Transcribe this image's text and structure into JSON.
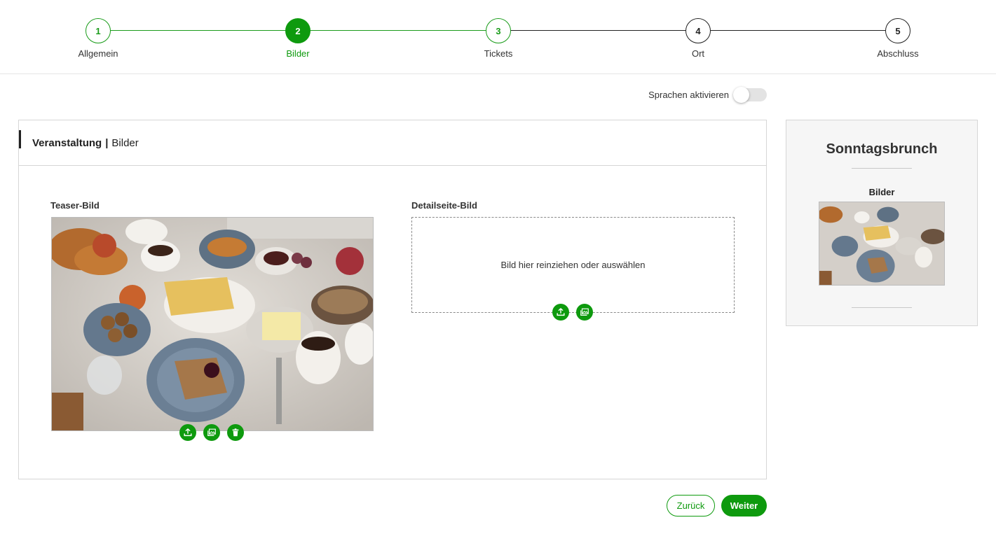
{
  "stepper": {
    "steps": [
      {
        "number": "1",
        "label": "Allgemein",
        "state": "done"
      },
      {
        "number": "2",
        "label": "Bilder",
        "state": "active"
      },
      {
        "number": "3",
        "label": "Tickets",
        "state": "done"
      },
      {
        "number": "4",
        "label": "Ort",
        "state": "pending"
      },
      {
        "number": "5",
        "label": "Abschluss",
        "state": "pending"
      }
    ],
    "colors": {
      "active": "#0e9a0e",
      "done": "#1a9c1a",
      "pending": "#222222"
    }
  },
  "language_toggle": {
    "label": "Sprachen aktivieren",
    "enabled": false
  },
  "card": {
    "title_bold": "Veranstaltung",
    "separator": "|",
    "title_rest": "Bilder",
    "teaser": {
      "label": "Teaser-Bild",
      "actions": [
        "upload-icon",
        "gallery-icon",
        "trash-icon"
      ]
    },
    "detail": {
      "label": "Detailseite-Bild",
      "dropzone_text": "Bild hier reinziehen oder auswählen",
      "actions": [
        "upload-icon",
        "gallery-icon"
      ]
    }
  },
  "preview": {
    "title": "Sonntagsbrunch",
    "images_label": "Bilder"
  },
  "footer": {
    "back_label": "Zurück",
    "next_label": "Weiter"
  },
  "accent_color": "#0e9a0e"
}
